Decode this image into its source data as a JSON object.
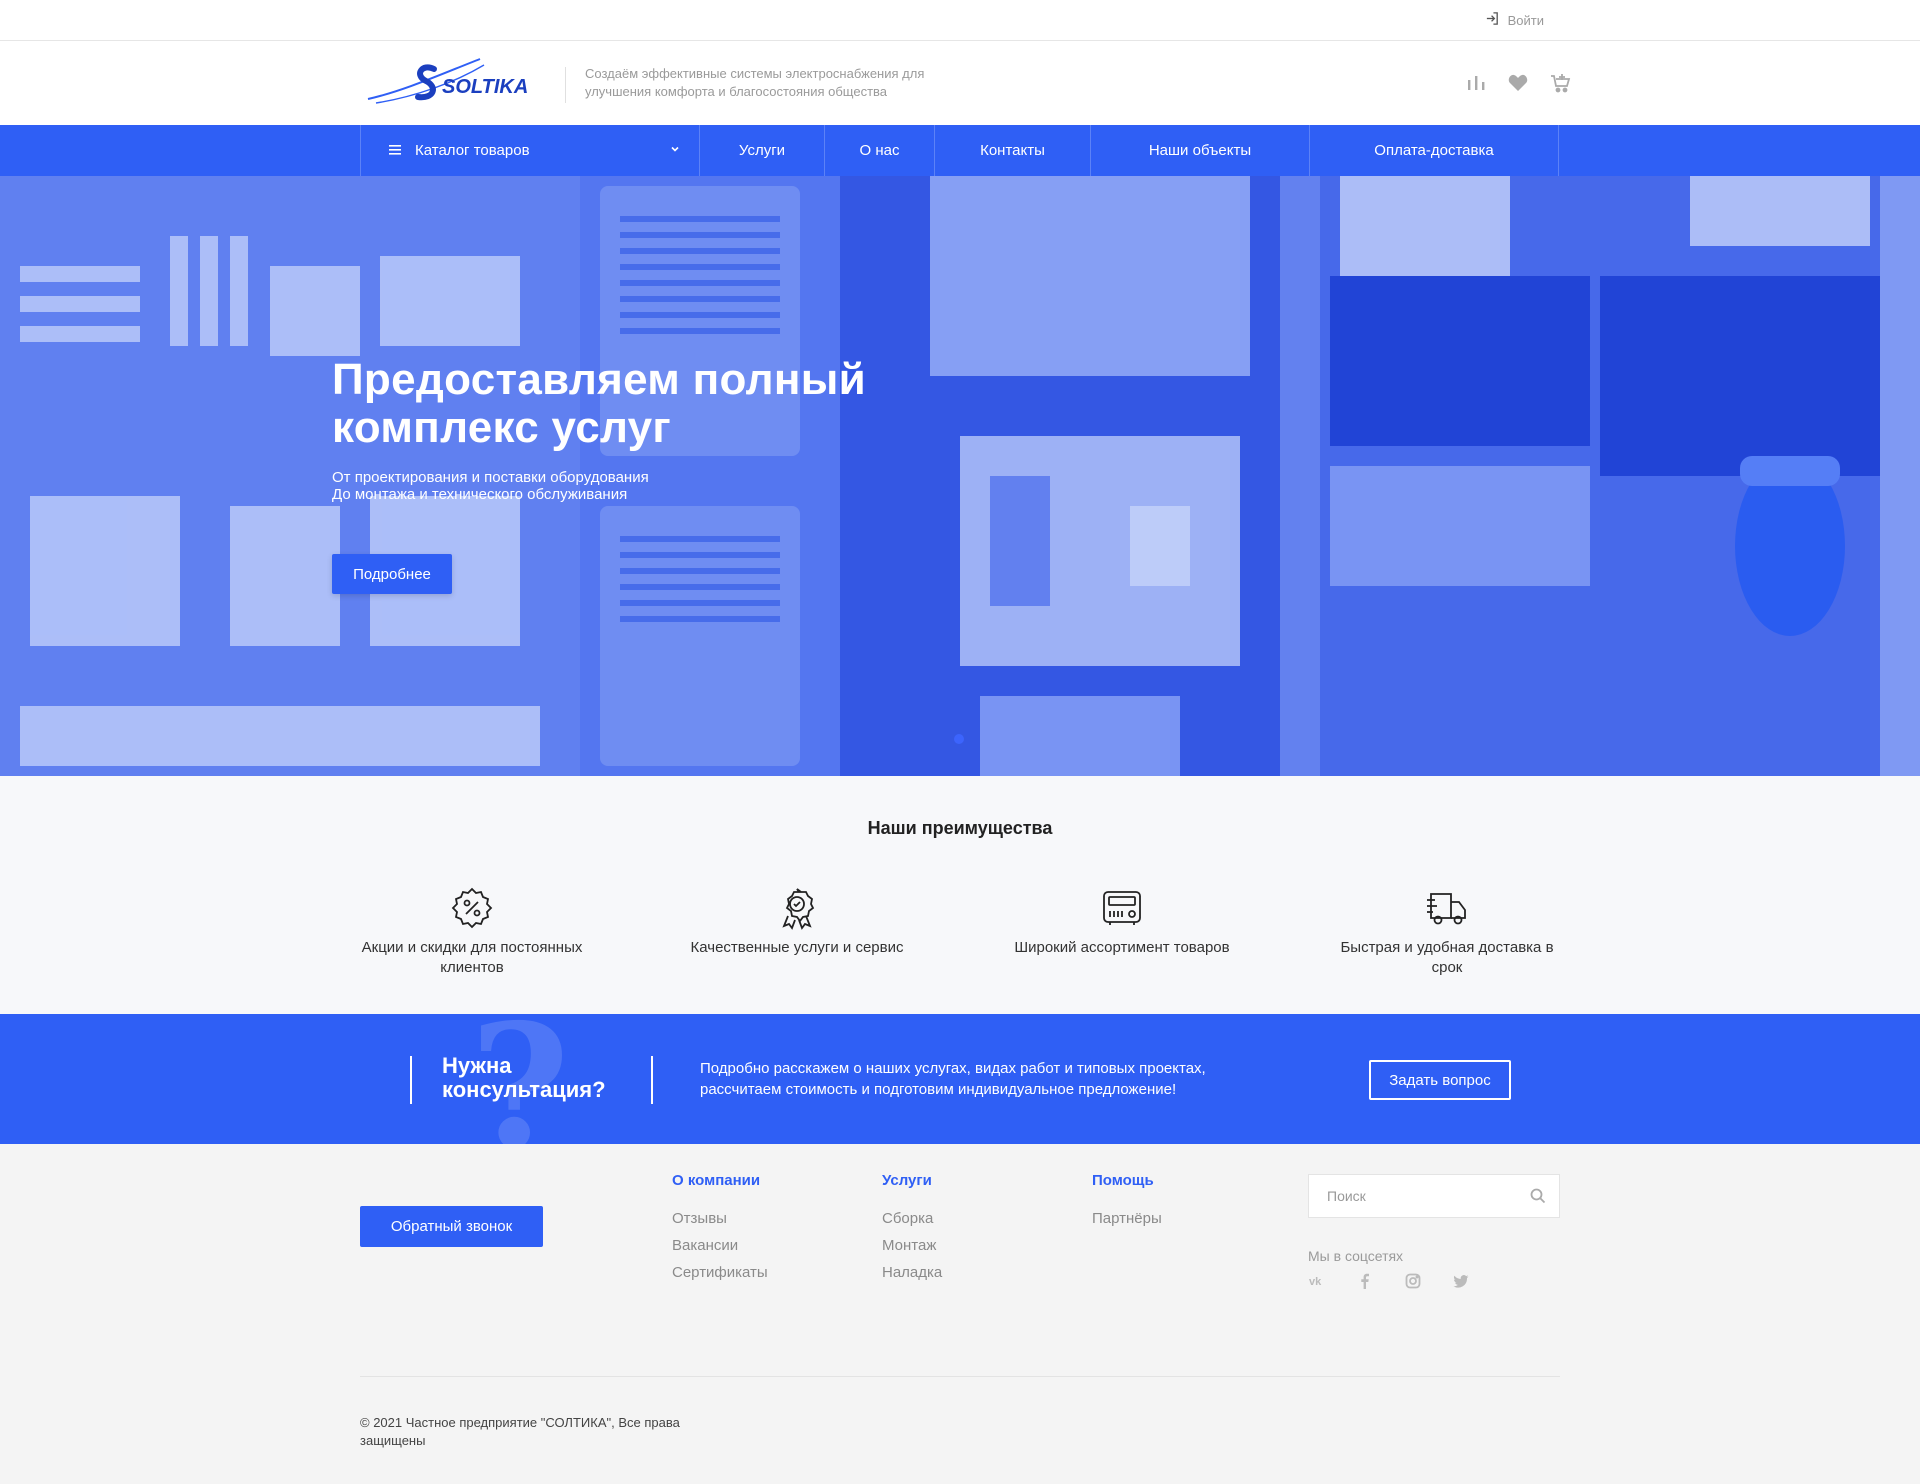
{
  "topbar": {
    "login_label": "Войти"
  },
  "header": {
    "logo_text": "SOLTIKA",
    "slogan": "Создаём эффективные системы электроснабжения для улучшения комфорта и благосостояния общества",
    "icons": [
      "compare-icon",
      "heart-icon",
      "cart-icon"
    ]
  },
  "nav": {
    "catalog_label": "Каталог товаров",
    "items": [
      {
        "label": "Услуги"
      },
      {
        "label": "О нас"
      },
      {
        "label": "Контакты"
      },
      {
        "label": "Наши объекты"
      },
      {
        "label": "Оплата-доставка"
      }
    ]
  },
  "hero": {
    "title": "Предоставляем полный комплекс услуг",
    "subtitle_line1": "От проектирования и поставки оборудования",
    "subtitle_line2": "До монтажа и технического обслуживания",
    "button_label": "Подробнее"
  },
  "advantages": {
    "title": "Наши преимущества",
    "items": [
      {
        "icon": "discount-badge-icon",
        "label": "Акции и скидки для постоянных клиентов"
      },
      {
        "icon": "award-icon",
        "label": "Качественные услуги и сервис"
      },
      {
        "icon": "device-panel-icon",
        "label": "Широкий ассортимент товаров"
      },
      {
        "icon": "delivery-truck-icon",
        "label": "Быстрая и удобная доставка в срок"
      }
    ]
  },
  "consult": {
    "title": "Нужна консультация?",
    "text": "Подробно расскажем о наших услугах, видах работ и типовых проектах, рассчитаем стоимость и подготовим индивидуальное предложение!",
    "button_label": "Задать вопрос",
    "decor_char": "?"
  },
  "footer": {
    "callback_label": "Обратный звонок",
    "columns": [
      {
        "heading": "О компании",
        "links": [
          "Отзывы",
          "Вакансии",
          "Сертификаты"
        ]
      },
      {
        "heading": "Услуги",
        "links": [
          "Сборка",
          "Монтаж",
          "Наладка"
        ]
      },
      {
        "heading": "Помощь",
        "links": [
          "Партнёры"
        ]
      }
    ],
    "search_placeholder": "Поиск",
    "social_title": "Мы в соцсетях",
    "social": [
      "vk-icon",
      "facebook-icon",
      "instagram-icon",
      "twitter-icon"
    ],
    "copyright": "© 2021 Частное предприятие \"СОЛТИКА\", Все права защищены"
  },
  "colors": {
    "accent": "#2f5ff5",
    "hero_tint": "#3a63f0",
    "text_muted": "#8a8a8a"
  }
}
